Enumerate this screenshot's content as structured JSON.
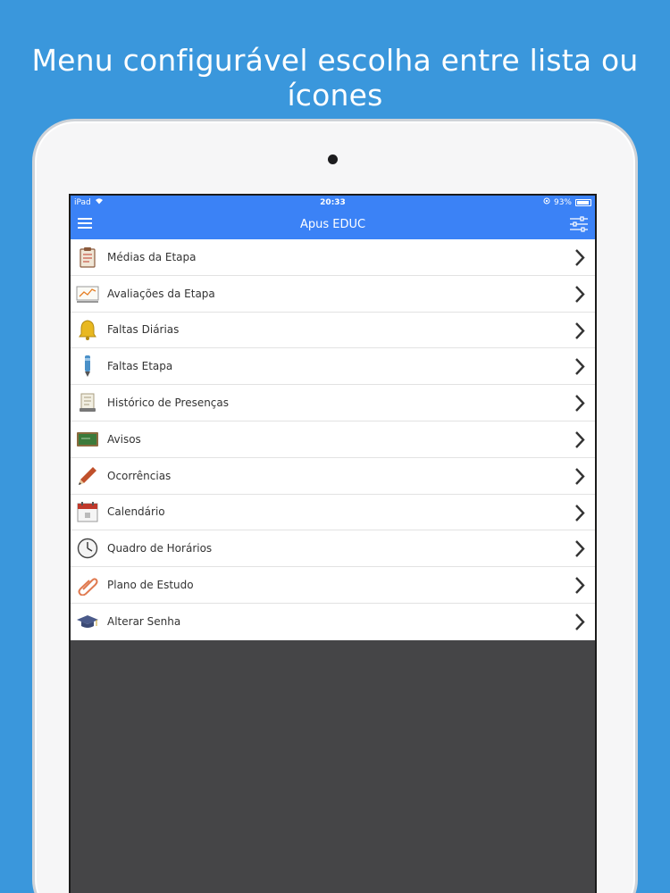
{
  "headline": "Menu configurável escolha entre lista ou ícones",
  "status_bar": {
    "device": "iPad",
    "time": "20:33",
    "battery": "93%",
    "battery_level": 0.93
  },
  "nav": {
    "title": "Apus EDUC",
    "menu_icon": "hamburger-icon",
    "settings_icon": "sliders-icon"
  },
  "menu": {
    "items": [
      {
        "label": "Médias da Etapa",
        "icon": "clipboard-icon"
      },
      {
        "label": "Avaliações da Etapa",
        "icon": "chart-board-icon"
      },
      {
        "label": "Faltas Diárias",
        "icon": "bell-icon"
      },
      {
        "label": "Faltas Etapa",
        "icon": "pen-icon"
      },
      {
        "label": "Histórico de Presenças",
        "icon": "document-icon"
      },
      {
        "label": "Avisos",
        "icon": "chalkboard-icon"
      },
      {
        "label": "Ocorrências",
        "icon": "pencil-icon"
      },
      {
        "label": "Calendário",
        "icon": "calendar-icon"
      },
      {
        "label": "Quadro de Horários",
        "icon": "clock-icon"
      },
      {
        "label": "Plano de Estudo",
        "icon": "paperclip-icon"
      },
      {
        "label": "Alterar Senha",
        "icon": "graduation-cap-icon"
      }
    ]
  },
  "colors": {
    "background": "#3a97dc",
    "nav_bar": "#3b82f6",
    "screen_empty": "#454547"
  }
}
